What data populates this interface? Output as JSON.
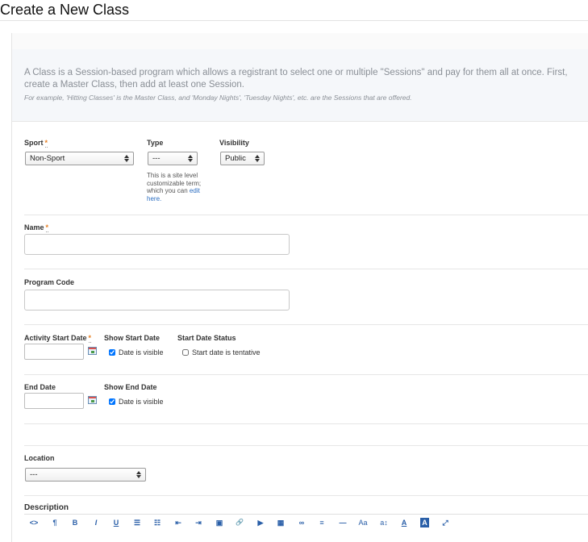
{
  "page": {
    "title": "Create a New Class"
  },
  "intro": {
    "text": "A Class is a Session-based program which allows a registrant to select one or multiple \"Sessions\" and pay for them all at once. First, create a Master Class, then add at least one Session.",
    "example": "For example, 'Hitting Classes' is the Master Class, and 'Monday Nights', 'Tuesday Nights', etc. are the Sessions that are offered."
  },
  "form": {
    "sport": {
      "label": "Sport",
      "required": "*",
      "value": "Non-Sport"
    },
    "type": {
      "label": "Type",
      "value": "---",
      "help_prefix": "This is a site level customizable term; which you can ",
      "help_link": "edit here."
    },
    "visibility": {
      "label": "Visibility",
      "value": "Public"
    },
    "name": {
      "label": "Name",
      "required": "*",
      "value": ""
    },
    "program_code": {
      "label": "Program Code",
      "value": ""
    },
    "activity_start_date": {
      "label": "Activity Start Date",
      "required": "*",
      "value": ""
    },
    "show_start_date": {
      "label": "Show Start Date",
      "checkbox_label": "Date is visible",
      "checked": true
    },
    "start_date_status": {
      "label": "Start Date Status",
      "checkbox_label": "Start date is tentative",
      "checked": false
    },
    "end_date": {
      "label": "End Date",
      "value": ""
    },
    "show_end_date": {
      "label": "Show End Date",
      "checkbox_label": "Date is visible",
      "checked": true
    },
    "location": {
      "label": "Location",
      "value": "---"
    },
    "description": {
      "label": "Description"
    }
  },
  "toolbar": {
    "items": [
      {
        "name": "code-view-icon",
        "glyph": "<>"
      },
      {
        "name": "paragraph-icon",
        "glyph": "¶"
      },
      {
        "name": "bold-icon",
        "glyph": "B"
      },
      {
        "name": "italic-icon",
        "glyph": "I"
      },
      {
        "name": "underline-icon",
        "glyph": "U"
      },
      {
        "name": "unordered-list-icon",
        "glyph": "☰"
      },
      {
        "name": "ordered-list-icon",
        "glyph": "☷"
      },
      {
        "name": "outdent-icon",
        "glyph": "⇤"
      },
      {
        "name": "indent-icon",
        "glyph": "⇥"
      },
      {
        "name": "image-icon",
        "glyph": "▣"
      },
      {
        "name": "link-icon",
        "glyph": "🔗"
      },
      {
        "name": "video-icon",
        "glyph": "▶"
      },
      {
        "name": "table-icon",
        "glyph": "▦"
      },
      {
        "name": "chain-icon",
        "glyph": "∞"
      },
      {
        "name": "align-icon",
        "glyph": "≡"
      },
      {
        "name": "horizontal-rule-icon",
        "glyph": "—"
      },
      {
        "name": "font-size-icon",
        "glyph": "Aa"
      },
      {
        "name": "line-height-icon",
        "glyph": "a↕"
      },
      {
        "name": "font-color-icon",
        "glyph": "A"
      },
      {
        "name": "background-color-icon",
        "glyph": "A"
      },
      {
        "name": "fullscreen-icon",
        "glyph": "⤢"
      }
    ]
  },
  "colors": {
    "accent": "#2a6cc0",
    "required": "#e67e22",
    "intro_bg": "#f5f7fa"
  }
}
